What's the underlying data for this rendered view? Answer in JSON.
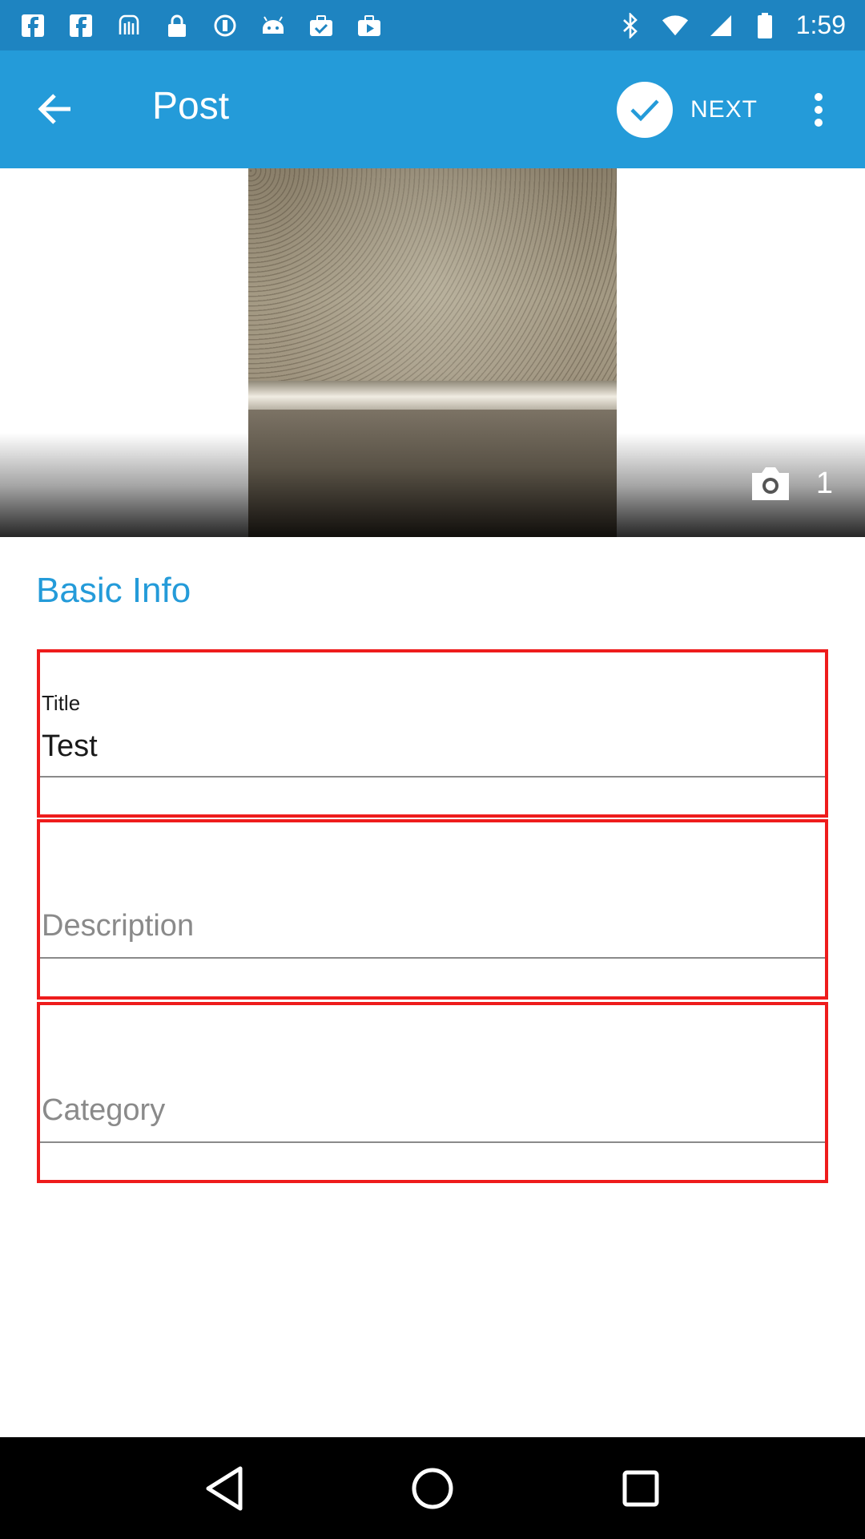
{
  "status_bar": {
    "time": "1:59",
    "left_icons": [
      "facebook-icon",
      "facebook-icon",
      "android-icon",
      "lock-icon",
      "circle-icon",
      "android-robot-icon",
      "briefcase-check-icon",
      "briefcase-play-icon"
    ],
    "right_icons": [
      "bluetooth-icon",
      "wifi-icon",
      "signal-icon",
      "battery-icon"
    ]
  },
  "toolbar": {
    "title": "Post",
    "next_label": "NEXT",
    "color": "#249bd9"
  },
  "photo": {
    "count": "1"
  },
  "section": {
    "title": "Basic Info"
  },
  "fields": {
    "title": {
      "label": "Title",
      "value": "Test"
    },
    "description": {
      "placeholder": "Description"
    },
    "category": {
      "placeholder": "Category"
    }
  },
  "colors": {
    "accent": "#249bd9",
    "status_bar": "#1e84c1",
    "highlight_border": "#ee1c1c"
  }
}
